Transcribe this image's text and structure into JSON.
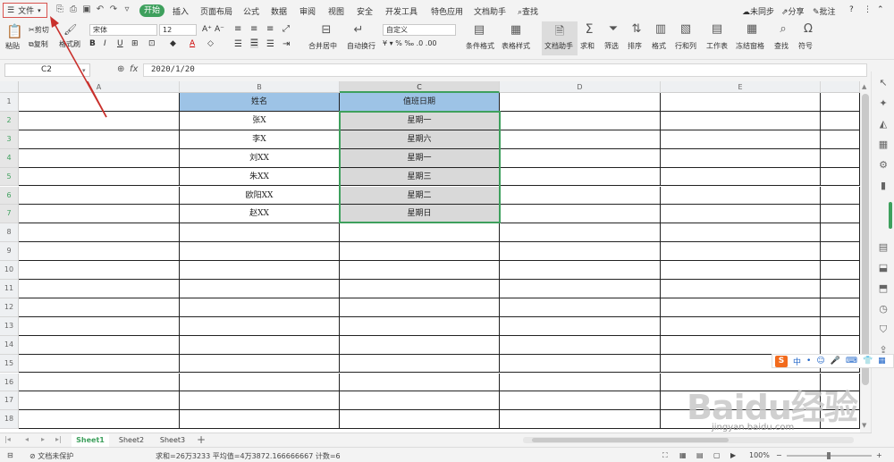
{
  "menubar": {
    "file_label": "文件",
    "tabs": [
      "开始",
      "插入",
      "页面布局",
      "公式",
      "数据",
      "审阅",
      "视图",
      "安全",
      "开发工具",
      "特色应用",
      "文档助手"
    ],
    "search_label": "查找",
    "right": {
      "sync": "未同步",
      "share": "分享",
      "annotate": "批注"
    }
  },
  "ribbon": {
    "paste": "粘贴",
    "cut": "剪切",
    "copy": "复制",
    "format_painter": "格式刷",
    "font_name": "宋体",
    "font_size": "12",
    "merge_center": "合并居中",
    "wrap_text": "自动换行",
    "number_format": "自定义",
    "conditional_format": "条件格式",
    "table_style": "表格样式",
    "doc_assistant": "文档助手",
    "sum": "求和",
    "filter": "筛选",
    "sort": "排序",
    "format": "格式",
    "row_col": "行和列",
    "worksheet": "工作表",
    "freeze": "冻结窗格",
    "find": "查找",
    "symbol": "符号"
  },
  "formula_bar": {
    "cell_ref": "C2",
    "fx": "fx",
    "value": "2020/1/20"
  },
  "sheet": {
    "columns": [
      "A",
      "B",
      "C",
      "D",
      "E"
    ],
    "rows": [
      "1",
      "2",
      "3",
      "4",
      "5",
      "6",
      "7",
      "8",
      "9",
      "10",
      "11",
      "12",
      "13",
      "14",
      "15",
      "16",
      "17",
      "18"
    ],
    "header": {
      "name": "姓名",
      "duty_date": "值班日期"
    },
    "records": [
      {
        "name": "张X",
        "day": "星期一"
      },
      {
        "name": "李X",
        "day": "星期六"
      },
      {
        "name": "刘XX",
        "day": "星期一"
      },
      {
        "name": "朱XX",
        "day": "星期三"
      },
      {
        "name": "欧阳XX",
        "day": "星期二"
      },
      {
        "name": "赵XX",
        "day": "星期日"
      }
    ]
  },
  "sheet_tabs": [
    "Sheet1",
    "Sheet2",
    "Sheet3"
  ],
  "status": {
    "protect": "文档未保护",
    "summary": "求和=26万3233  平均值=4万3872.166666667  计数=6",
    "zoom": "100%"
  },
  "ime": {
    "mode": "中"
  },
  "watermark": {
    "brand": "Baidu经验",
    "url": "jingyan.baidu.com"
  },
  "colors": {
    "accent": "#3ea05d",
    "header_fill": "#9dc3e6",
    "selected_fill": "#d9d9d9",
    "annotation": "#d9534f"
  }
}
